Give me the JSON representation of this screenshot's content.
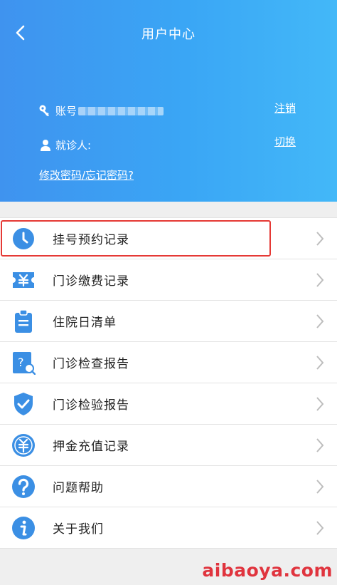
{
  "header": {
    "title": "用户中心",
    "account_label": "账号",
    "patient_label": "就诊人:",
    "logout_link": "注销",
    "switch_link": "切换",
    "password_link": "修改密码/忘记密码?"
  },
  "menu": {
    "items": [
      {
        "label": "挂号预约记录",
        "icon": "clock-icon"
      },
      {
        "label": "门诊缴费记录",
        "icon": "yen-ticket-icon"
      },
      {
        "label": "住院日清单",
        "icon": "clipboard-icon"
      },
      {
        "label": "门诊检查报告",
        "icon": "report-search-icon"
      },
      {
        "label": "门诊检验报告",
        "icon": "shield-check-icon"
      },
      {
        "label": "押金充值记录",
        "icon": "deposit-icon"
      },
      {
        "label": "问题帮助",
        "icon": "question-icon"
      },
      {
        "label": "关于我们",
        "icon": "info-icon"
      }
    ]
  },
  "colors": {
    "header_start": "#3f93ef",
    "header_end": "#43b8f8",
    "icon_blue": "#3b8fe4",
    "highlight_red": "#e53935"
  },
  "watermark": "aibaoya.com"
}
